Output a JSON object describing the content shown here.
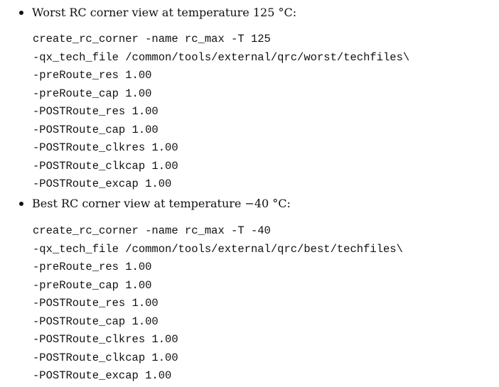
{
  "sections": [
    {
      "heading": "Worst RC corner view at temperature 125 °C:",
      "code": [
        "create_rc_corner -name rc_max -T 125",
        "-qx_tech_file /common/tools/external/qrc/worst/techfiles\\",
        "-preRoute_res 1.00",
        "-preRoute_cap 1.00",
        "-POSTRoute_res 1.00",
        "-POSTRoute_cap 1.00",
        "-POSTRoute_clkres 1.00",
        "-POSTRoute_clkcap 1.00",
        "-POSTRoute_excap 1.00"
      ]
    },
    {
      "heading": "Best RC corner view at temperature −40 °C:",
      "code": [
        "create_rc_corner -name rc_max -T -40",
        "-qx_tech_file /common/tools/external/qrc/best/techfiles\\",
        "-preRoute_res 1.00",
        "-preRoute_cap 1.00",
        "-POSTRoute_res 1.00",
        "-POSTRoute_cap 1.00",
        "-POSTRoute_clkres 1.00",
        "-POSTRoute_clkcap 1.00",
        "-POSTRoute_excap 1.00"
      ]
    }
  ]
}
